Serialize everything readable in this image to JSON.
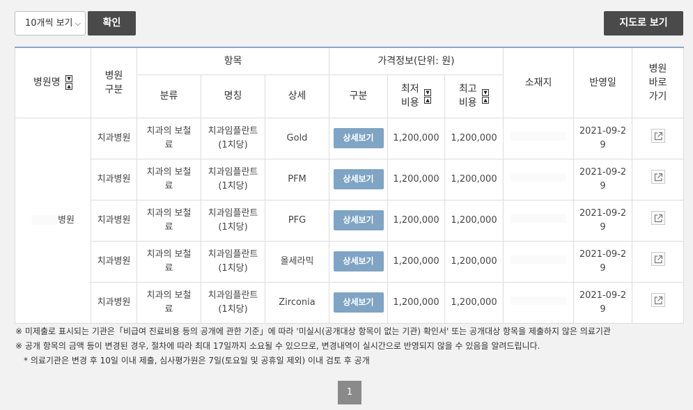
{
  "toolbar": {
    "page_size_value": "10개씩 보기",
    "confirm_label": "확인",
    "map_view_label": "지도로 보기"
  },
  "table": {
    "headers": {
      "hospital_name": "병원명",
      "hospital_type_1": "병원",
      "hospital_type_2": "구분",
      "item_group": "항목",
      "price_group": "가격정보(단위: 원)",
      "category": "분류",
      "name": "명칭",
      "detail": "상세",
      "price_type": "구분",
      "min_cost_1": "최저",
      "min_cost_2": "비용",
      "max_cost_1": "최고",
      "max_cost_2": "비용",
      "location": "소재지",
      "reflected_date": "반영일",
      "goto_1": "병원",
      "goto_2": "바로",
      "goto_3": "가기"
    },
    "hospital_name": "병원",
    "rows": [
      {
        "type": "치과병원",
        "category_1": "치과의 보철",
        "category_2": "료",
        "name_1": "치과임플란트",
        "name_2": "(1치당)",
        "detail": "Gold",
        "button": "상세보기",
        "min": "1,200,000",
        "max": "1,200,000",
        "date_1": "2021-09-2",
        "date_2": "9"
      },
      {
        "type": "치과병원",
        "category_1": "치과의 보철",
        "category_2": "료",
        "name_1": "치과임플란트",
        "name_2": "(1치당)",
        "detail": "PFM",
        "button": "상세보기",
        "min": "1,200,000",
        "max": "1,200,000",
        "date_1": "2021-09-2",
        "date_2": "9"
      },
      {
        "type": "치과병원",
        "category_1": "치과의 보철",
        "category_2": "료",
        "name_1": "치과임플란트",
        "name_2": "(1치당)",
        "detail": "PFG",
        "button": "상세보기",
        "min": "1,200,000",
        "max": "1,200,000",
        "date_1": "2021-09-2",
        "date_2": "9"
      },
      {
        "type": "치과병원",
        "category_1": "치과의 보철",
        "category_2": "료",
        "name_1": "치과임플란트",
        "name_2": "(1치당)",
        "detail": "올세라믹",
        "button": "상세보기",
        "min": "1,200,000",
        "max": "1,200,000",
        "date_1": "2021-09-2",
        "date_2": "9"
      },
      {
        "type": "치과병원",
        "category_1": "치과의 보철",
        "category_2": "료",
        "name_1": "치과임플란트",
        "name_2": "(1치당)",
        "detail": "Zirconia",
        "button": "상세보기",
        "min": "1,200,000",
        "max": "1,200,000",
        "date_1": "2021-09-2",
        "date_2": "9"
      }
    ]
  },
  "notes": {
    "line1": "※ 미제출로 표시되는 기관은「비급여 진료비용 등의 공개에 관한 기준」에 따라 '미실시(공개대상 항목이 없는 기관) 확인서' 또는 공개대상 항목을 제출하지 않은 의료기관",
    "line2": "※ 공개 항목의 금액 등이 변경된 경우, 절차에 따라 최대 17일까지 소요될 수 있으므로, 변경내역이 실시간으로 반영되지 않을 수 있음을 알려드립니다.",
    "line3": "* 의료기관은 변경 후 10일 이내 제출, 심사평가원은 7일(토요일 및 공휴일 제외) 이내 검토 후 공개"
  },
  "pagination": {
    "current": "1"
  },
  "icons": {
    "sort": "sort-up-down-icon",
    "external_link": "external-link-icon",
    "dropdown": "chevron-down-icon"
  }
}
